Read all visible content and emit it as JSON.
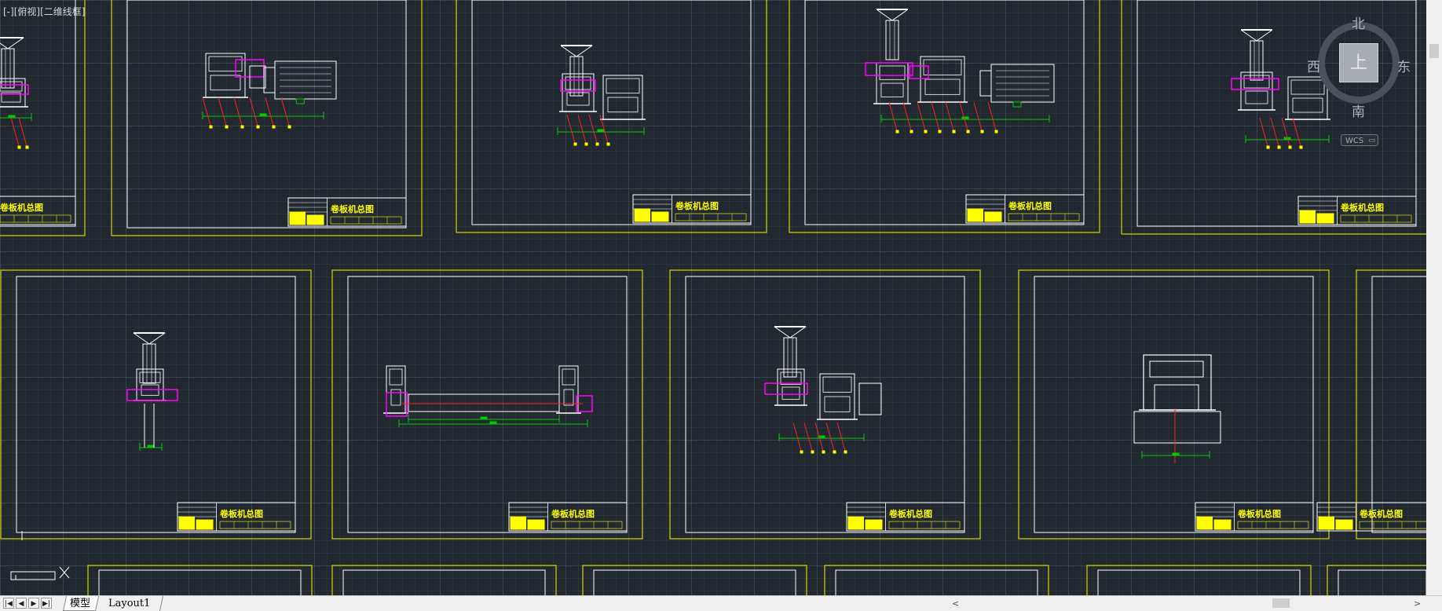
{
  "viewport": {
    "label_minus": "[-]",
    "label_view": "[俯视]",
    "label_style": "[二维线框]"
  },
  "viewcube": {
    "top_face": "上",
    "north": "北",
    "south": "南",
    "east": "东",
    "west": "西",
    "wcs_label": "WCS"
  },
  "tabs": {
    "model": "模型",
    "layout1": "Layout1"
  },
  "drawing": {
    "sheet_title": "卷板机总图"
  },
  "colors": {
    "background": "#212830",
    "frame": "#d4d400",
    "title_block": "#ffff00",
    "geometry": "#ffffff",
    "part_highlight": "#ff00ff",
    "dimension": "#00cc00",
    "leader": "#ff2020"
  }
}
